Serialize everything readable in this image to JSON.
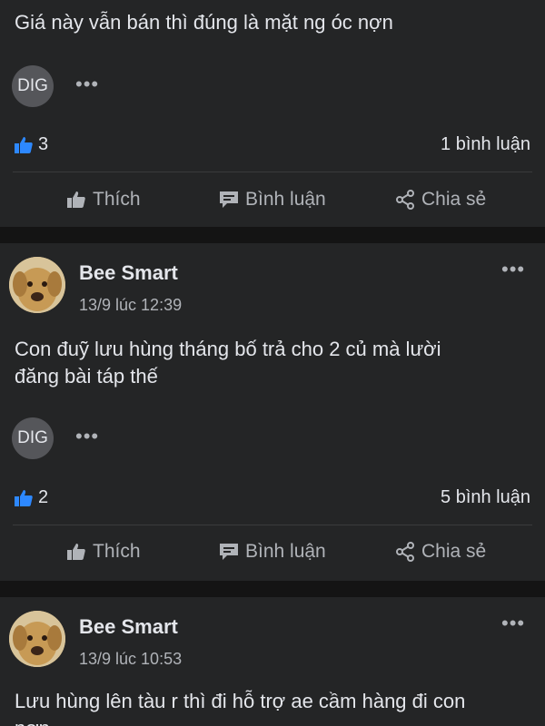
{
  "posts": [
    {
      "text": "Giá này vẫn bán thì đúng là mặt ng óc nợn",
      "reaction_badge": "DIG",
      "more_label": "•••",
      "like_count": "3",
      "comment_count": "1 bình luận",
      "actions": {
        "like": "Thích",
        "comment": "Bình luận",
        "share": "Chia sẻ"
      }
    },
    {
      "author": "Bee Smart",
      "time": "13/9 lúc 12:39",
      "more_label": "•••",
      "text_lines": [
        "Con đuỹ lưu hùng tháng bố trả cho 2 củ mà lười",
        "đăng bài táp thế"
      ],
      "reaction_badge": "DIG",
      "reaction_more": "•••",
      "like_count": "2",
      "comment_count": "5 bình luận",
      "actions": {
        "like": "Thích",
        "comment": "Bình luận",
        "share": "Chia sẻ"
      }
    },
    {
      "author": "Bee Smart",
      "time": "13/9 lúc 10:53",
      "more_label": "•••",
      "text_lines": [
        "Lưu hùng lên tàu r thì đi hỗ trợ ae cầm hàng đi con",
        "nợn"
      ]
    }
  ],
  "colors": {
    "background": "#141414",
    "card": "#242526",
    "like_blue": "#2d88ff"
  },
  "icons": [
    "thumbs-up-icon",
    "comment-icon",
    "share-icon",
    "more-dots-icon",
    "dog-avatar"
  ]
}
